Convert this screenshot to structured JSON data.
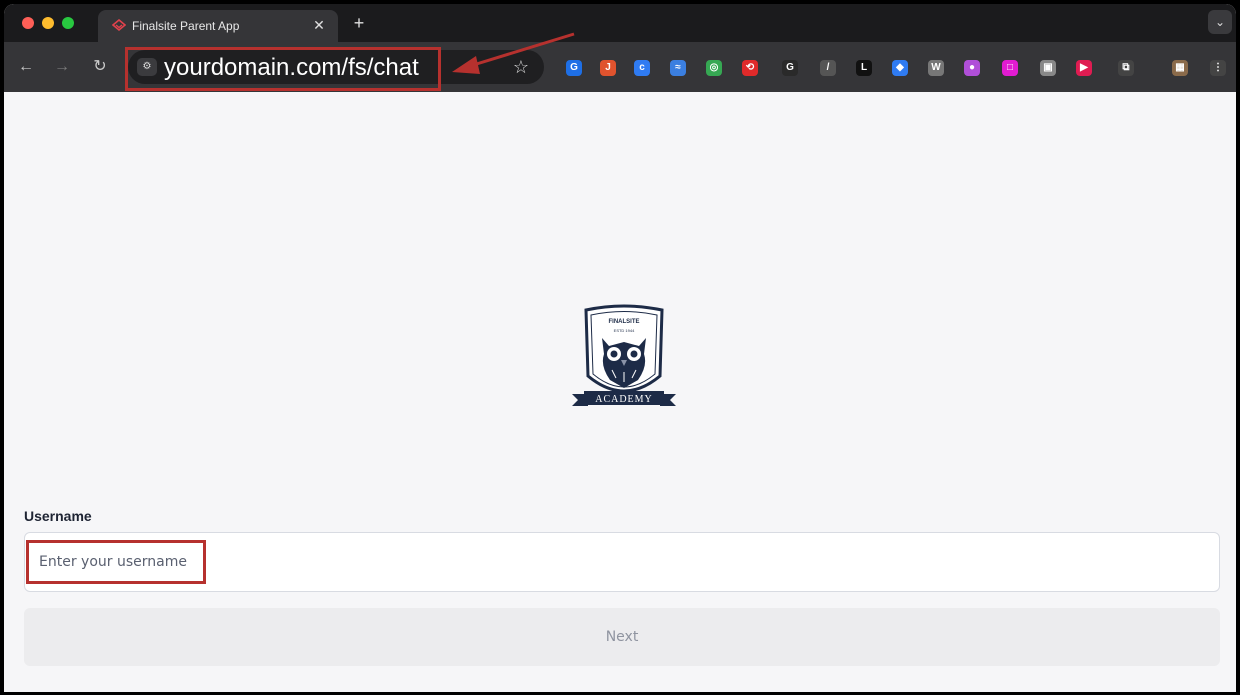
{
  "browser": {
    "tab_title": "Finalsite Parent App",
    "tab_close": "✕",
    "new_tab": "+",
    "tab_menu": "⌄",
    "nav_back": "←",
    "nav_forward": "→",
    "nav_reload": "↻",
    "url": "yourdomain.com/fs/chat",
    "bookmark": "☆"
  },
  "extensions": [
    {
      "name": "extension-1",
      "glyph": "G",
      "color": "#1e6fe6"
    },
    {
      "name": "extension-2",
      "glyph": "J",
      "color": "#e0532e"
    },
    {
      "name": "extension-3",
      "glyph": "c",
      "color": "#2f7bf2"
    },
    {
      "name": "extension-4",
      "glyph": "≈",
      "color": "#3b7fe0"
    },
    {
      "name": "extension-5",
      "glyph": "◎",
      "color": "#36a853"
    },
    {
      "name": "extension-6",
      "glyph": "⟲",
      "color": "#e02a2a"
    },
    {
      "name": "extension-7",
      "glyph": "G",
      "color": "#2a2a2a"
    },
    {
      "name": "extension-8",
      "glyph": "/",
      "color": "#555"
    },
    {
      "name": "extension-9",
      "glyph": "L",
      "color": "#111"
    },
    {
      "name": "extension-10",
      "glyph": "◆",
      "color": "#2f7bf2"
    },
    {
      "name": "extension-11",
      "glyph": "W",
      "color": "#777"
    },
    {
      "name": "extension-12",
      "glyph": "●",
      "color": "#b04fd8"
    },
    {
      "name": "extension-13",
      "glyph": "□",
      "color": "#e21cd2"
    },
    {
      "name": "extension-14",
      "glyph": "▣",
      "color": "#888"
    },
    {
      "name": "extension-15",
      "glyph": "▶",
      "color": "#e01c52"
    },
    {
      "name": "extension-16",
      "glyph": "⧉",
      "color": "#444"
    },
    {
      "name": "extension-17",
      "glyph": "▦",
      "color": "#8a6a4a"
    },
    {
      "name": "extension-18",
      "glyph": "⋮",
      "color": "#444"
    }
  ],
  "logo": {
    "top_text": "FINALSITE",
    "est_text": "ESTD 1944",
    "banner_text": "ACADEMY"
  },
  "login": {
    "username_label": "Username",
    "username_placeholder": "Enter your username",
    "username_value": "",
    "next_label": "Next"
  },
  "colors": {
    "annotation_red": "#b6312e",
    "logo_navy": "#1d2b47"
  }
}
